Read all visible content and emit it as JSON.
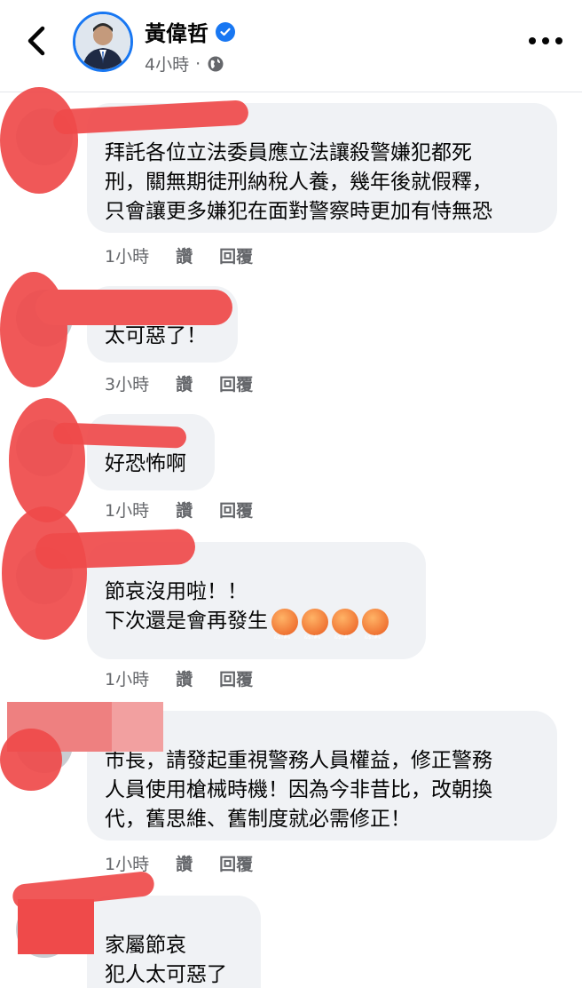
{
  "post": {
    "author": "黃偉哲",
    "time": "4小時",
    "separator": "·"
  },
  "icons": {
    "back": "chevron-left-icon",
    "verified": "verified-badge-icon",
    "privacy": "globe-icon",
    "more": "more-horizontal-icon"
  },
  "actions": {
    "like": "讚",
    "reply": "回覆"
  },
  "comments": [
    {
      "author": "",
      "text": "拜託各位立法委員應立法讓殺警嫌犯都死\n刑，關無期徒刑納稅人養，幾年後就假釋，\n只會讓更多嫌犯在面對警察時更加有恃無恐",
      "time": "1小時"
    },
    {
      "author": "",
      "text": "太可惡了！",
      "time": "3小時"
    },
    {
      "author": "",
      "text": "好恐怖啊",
      "time": "1小時"
    },
    {
      "author": "",
      "text": "節哀沒用啦！！",
      "text2": "下次還是會再發生",
      "time": "1小時"
    },
    {
      "author": "",
      "text": "市長，請發起重視警務人員權益，修正警務\n人員使用槍械時機！因為今非昔比，改朝換\n代，舊思維、舊制度就必需修正！",
      "time": "1小時"
    },
    {
      "author": "",
      "text": "家屬節哀\n犯人太可惡了",
      "time": ""
    }
  ],
  "colors": {
    "accent": "#1877f2",
    "bubble": "#f0f2f5",
    "redaction": "#ef4a4a"
  }
}
